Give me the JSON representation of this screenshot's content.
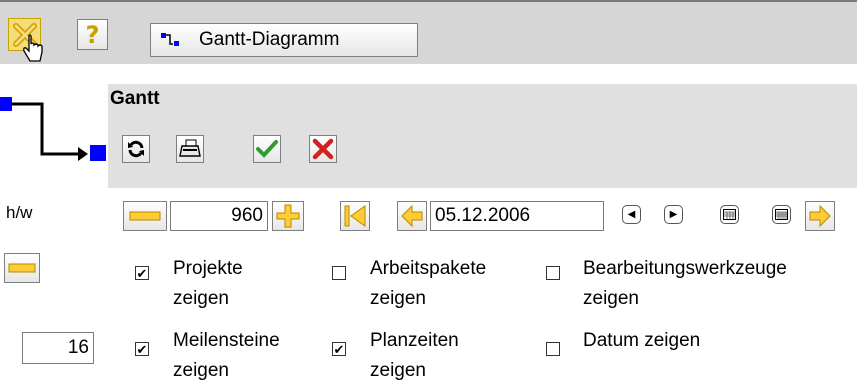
{
  "toolbar": {
    "close_icon": "close-x-icon",
    "help_icon": "help-question-icon",
    "tab_label": "Gantt-Diagramm",
    "tab_icon": "gantt-diagram-icon"
  },
  "panel": {
    "title": "Gantt",
    "actions": [
      "refresh-icon",
      "print-icon",
      "confirm-check-icon",
      "cancel-x-icon"
    ]
  },
  "zoom": {
    "label": "h/w",
    "width_value": "960",
    "row_value": "16"
  },
  "date": {
    "value": "05.12.2006"
  },
  "options": [
    {
      "label_line1": "Projekte",
      "label_line2": "zeigen",
      "checked": true
    },
    {
      "label_line1": "Arbeitspakete",
      "label_line2": "zeigen",
      "checked": false
    },
    {
      "label_line1": "Bearbeitungswerkzeuge",
      "label_line2": "zeigen",
      "checked": false
    },
    {
      "label_line1": "Meilensteine",
      "label_line2": "zeigen",
      "checked": true
    },
    {
      "label_line1": "Planzeiten",
      "label_line2": "zeigen",
      "checked": true
    },
    {
      "label_line1": "Datum zeigen",
      "label_line2": "",
      "checked": false
    }
  ],
  "colors": {
    "accent_blue": "#0000ff",
    "arrow_yellow": "#ffcc33",
    "check_green": "#2e9e2e",
    "cancel_red": "#d42020"
  }
}
